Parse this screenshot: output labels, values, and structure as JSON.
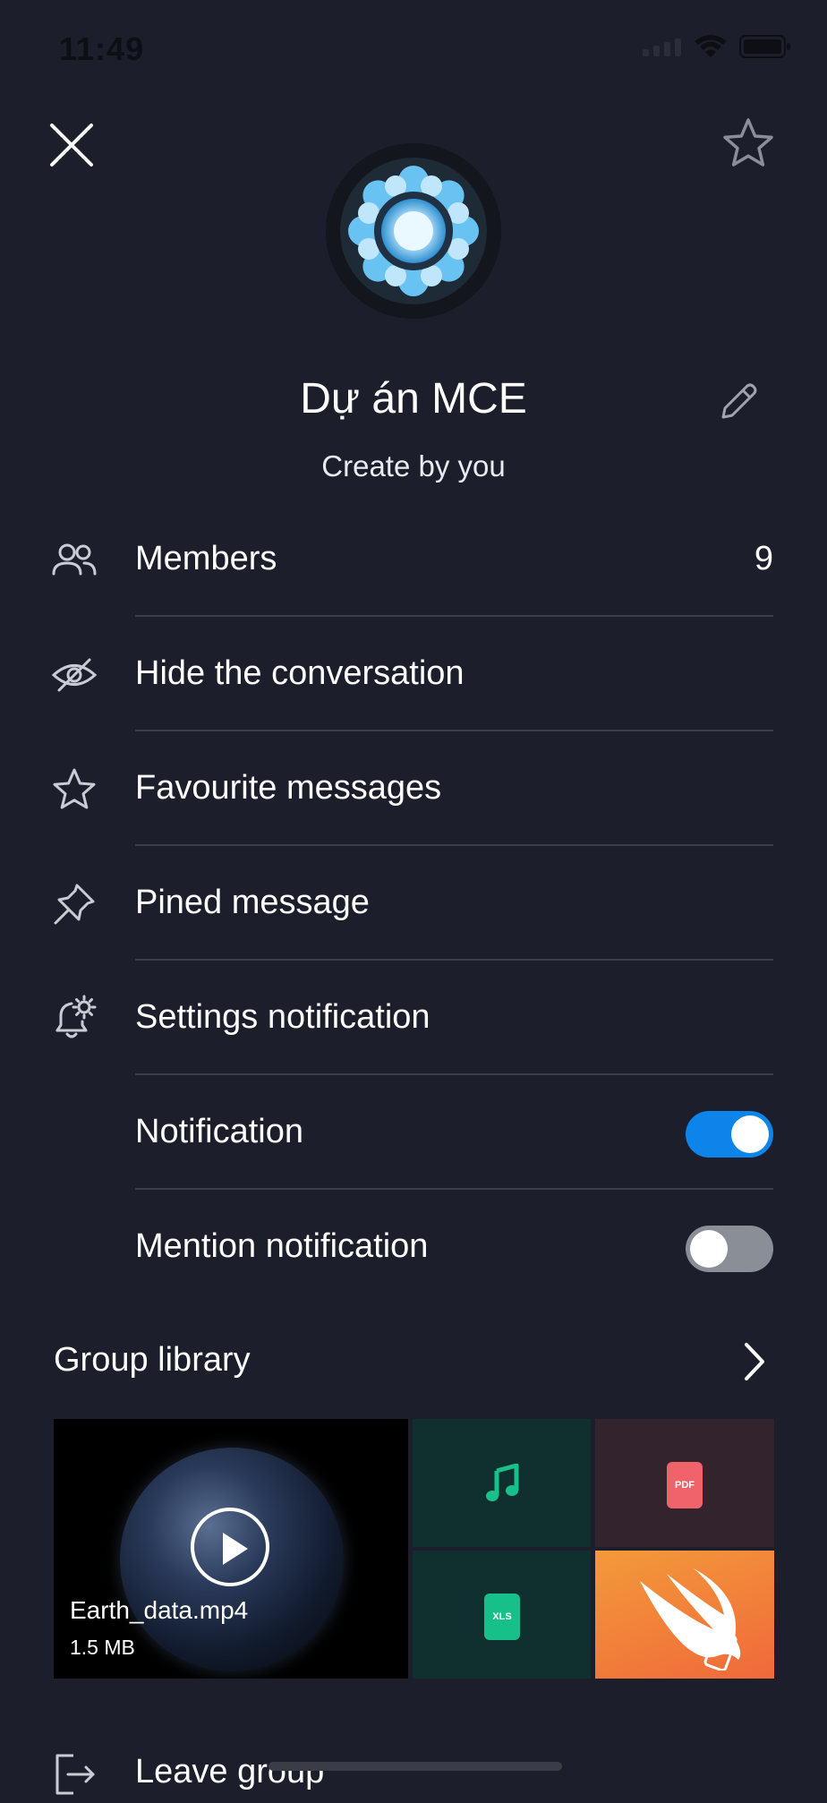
{
  "status_bar": {
    "time": "11:49"
  },
  "header": {
    "group_name": "Dự án MCE",
    "subtitle": "Create by you"
  },
  "menu": {
    "members_label": "Members",
    "members_count": "9",
    "hide_label": "Hide the conversation",
    "favourite_label": "Favourite messages",
    "pinned_label": "Pined message",
    "settings_label": "Settings notification",
    "notification_label": "Notification",
    "notification_on": true,
    "mention_label": "Mention notification",
    "mention_on": false
  },
  "library": {
    "title": "Group library",
    "video_name": "Earth_data.mp4",
    "video_size": "1.5 MB",
    "pdf_badge": "PDF",
    "xls_badge": "XLS"
  },
  "leave_label": "Leave group",
  "colors": {
    "background": "#1c1f2b",
    "accent": "#0d84ea",
    "music_icon": "#19c08a",
    "pdf_badge": "#f0636b",
    "xls_badge": "#17c089"
  }
}
